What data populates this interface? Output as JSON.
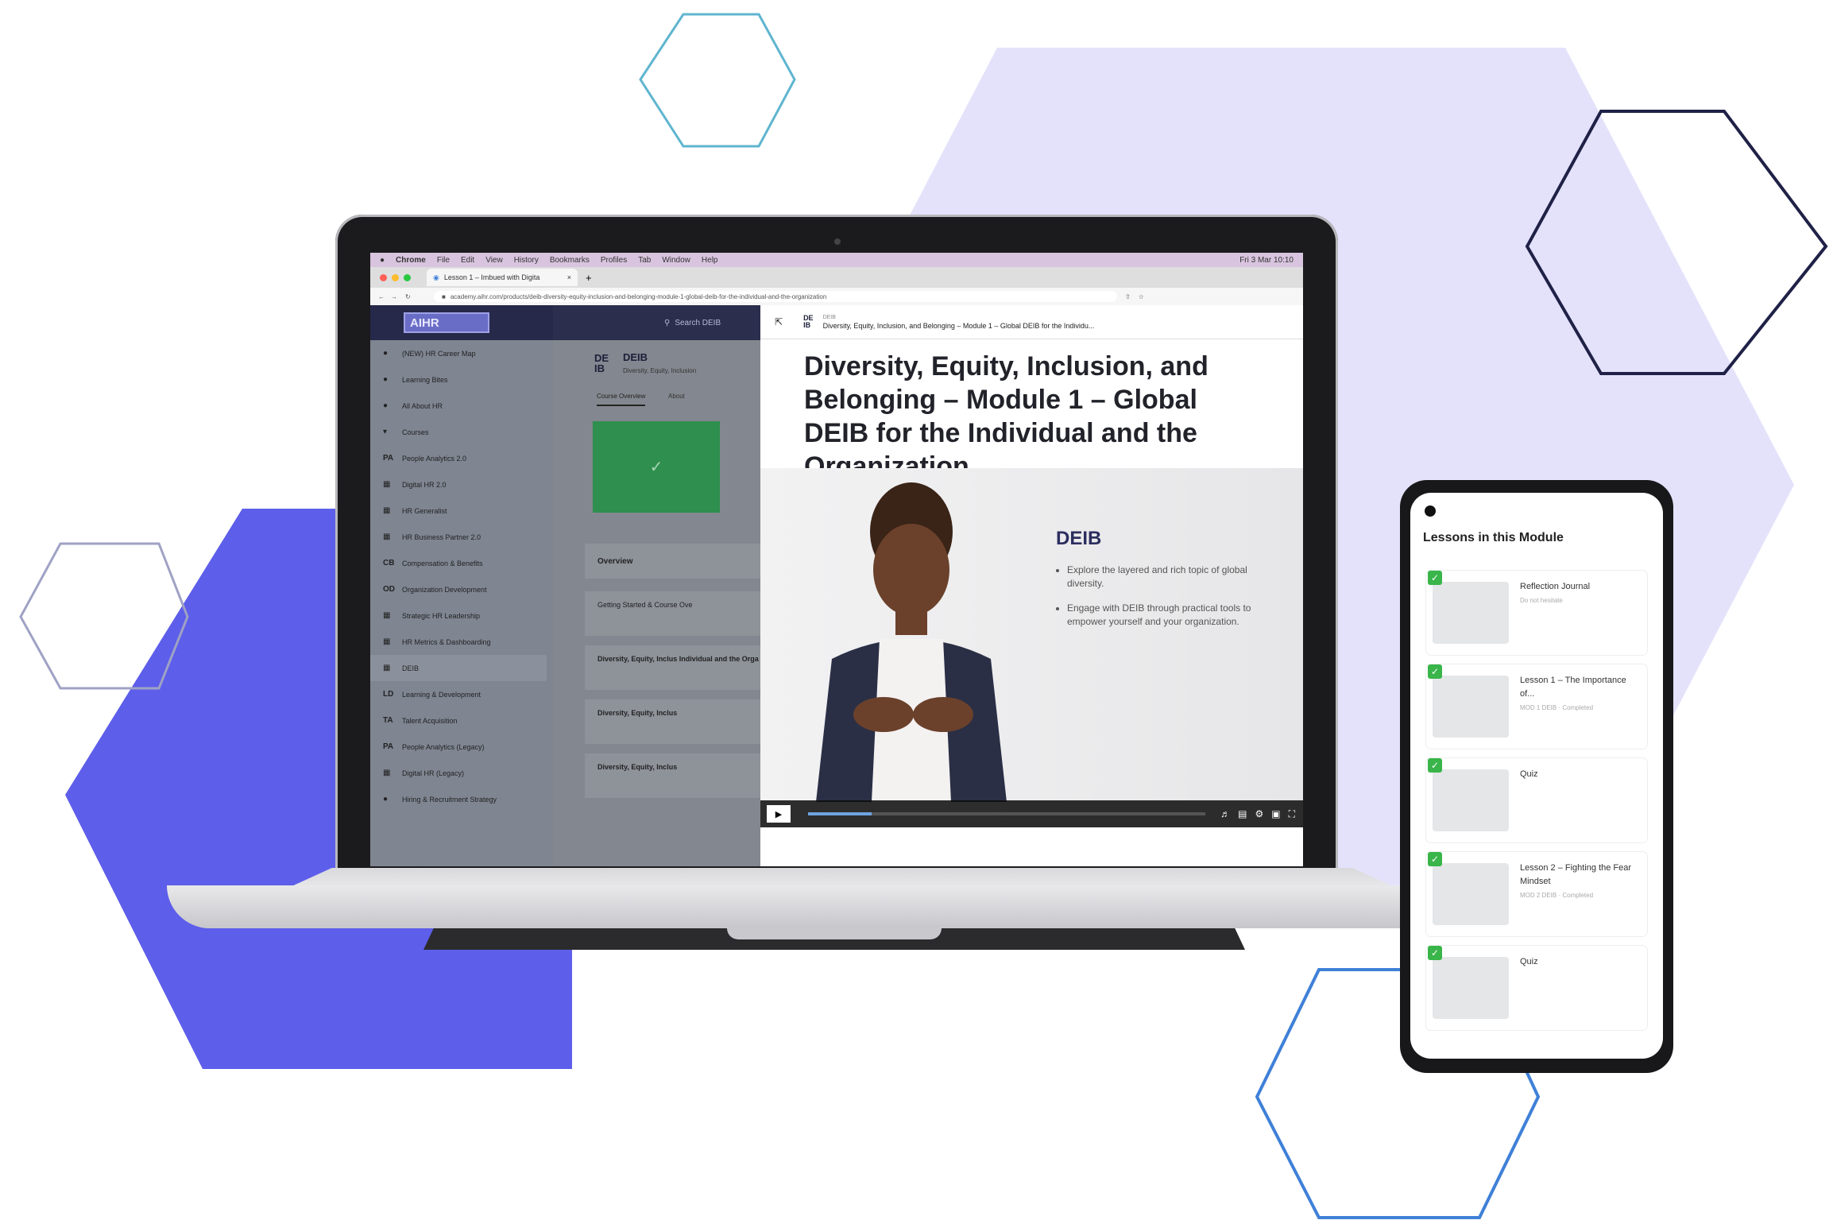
{
  "colors": {
    "lavender": "#e4e2fb",
    "indigo": "#5d5eea",
    "hex_teal": "#5fb5cf",
    "hex_navy": "#1f2147",
    "hex_gray": "#9fa2c4",
    "hex_blue": "#3f80d8"
  },
  "browser": {
    "menu": [
      "Chrome",
      "File",
      "Edit",
      "View",
      "History",
      "Bookmarks",
      "Profiles",
      "Tab",
      "Window",
      "Help"
    ],
    "clock": "Fri 3 Mar 10:10",
    "tab_title": "Lesson 1 – Imbued with Digita",
    "url": "academy.aihr.com/products/deib-diversity-equity-inclusion-and-belonging-module-1-global-deib-for-the-individual-and-the-organization"
  },
  "sidebar": {
    "logo": "AIHR",
    "items": [
      {
        "abbr": "●",
        "label": "(NEW) HR Career Map"
      },
      {
        "abbr": "●",
        "label": "Learning Bites"
      },
      {
        "abbr": "●",
        "label": "All About HR"
      },
      {
        "abbr": "▾",
        "label": "Courses"
      },
      {
        "abbr": "PA",
        "label": "People Analytics 2.0"
      },
      {
        "abbr": "▦",
        "label": "Digital HR 2.0"
      },
      {
        "abbr": "▦",
        "label": "HR Generalist"
      },
      {
        "abbr": "▦",
        "label": "HR Business Partner 2.0"
      },
      {
        "abbr": "CB",
        "label": "Compensation & Benefits"
      },
      {
        "abbr": "OD",
        "label": "Organization Development"
      },
      {
        "abbr": "▦",
        "label": "Strategic HR Leadership"
      },
      {
        "abbr": "▦",
        "label": "HR Metrics & Dashboarding"
      },
      {
        "abbr": "▦",
        "label": "DEIB"
      },
      {
        "abbr": "LD",
        "label": "Learning & Development"
      },
      {
        "abbr": "TA",
        "label": "Talent Acquisition"
      },
      {
        "abbr": "PA",
        "label": "People Analytics (Legacy)"
      },
      {
        "abbr": "▦",
        "label": "Digital HR (Legacy)"
      },
      {
        "abbr": "●",
        "label": "Hiring & Recruitment Strategy"
      }
    ]
  },
  "main": {
    "search": "Search DEIB",
    "course_logo_top": "DE",
    "course_logo_bottom": "IB",
    "course_name": "DEIB",
    "course_sub": "Diversity, Equity, Inclusion",
    "tabs": [
      "Course Overview",
      "About"
    ],
    "overview": "Overview",
    "rows": [
      "Getting Started & Course Ove",
      "Diversity, Equity, Inclus Individual and the Orga",
      "Diversity, Equity, Inclus",
      "Diversity, Equity, Inclus"
    ]
  },
  "panel": {
    "breadcrumb_small": "DEIB",
    "breadcrumb": "Diversity, Equity, Inclusion, and Belonging – Module 1 – Global DEIB for the Individu...",
    "title": "Diversity, Equity, Inclusion, and Belonging – Module 1 – Global DEIB for the Individual and the Organization",
    "video_heading": "DEIB",
    "bullets": [
      "Explore the layered and rich topic of global diversity.",
      "Engage with DEIB through practical tools to empower yourself and your organization."
    ],
    "progress": 0.16
  },
  "phone": {
    "heading": "Lessons in this Module",
    "lessons": [
      {
        "title": "Reflection Journal",
        "sub": "Do not hesitate"
      },
      {
        "title": "Lesson 1 – The Importance of...",
        "sub": "MOD 1 DEIB · Completed"
      },
      {
        "title": "Quiz",
        "sub": ""
      },
      {
        "title": "Lesson 2 – Fighting the Fear Mindset",
        "sub": "MOD 2 DEIB · Completed"
      },
      {
        "title": "Quiz",
        "sub": ""
      }
    ]
  }
}
